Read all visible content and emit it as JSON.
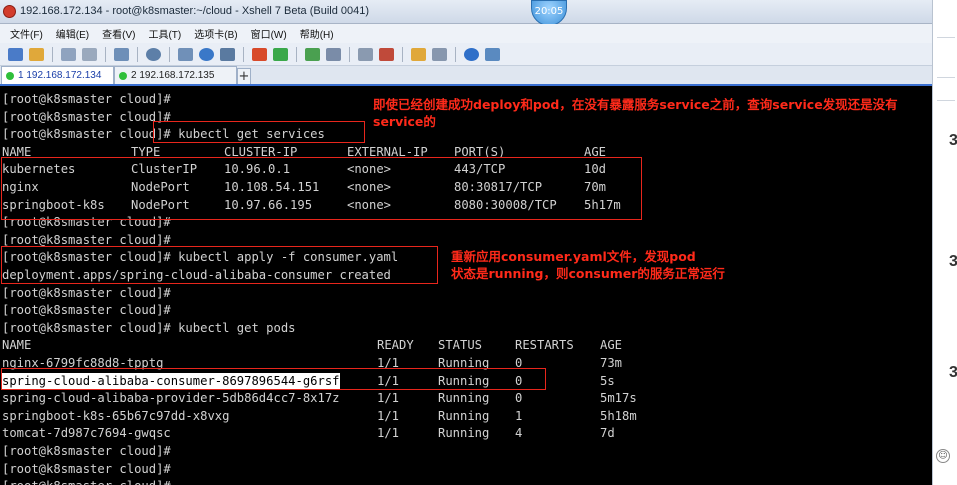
{
  "window": {
    "title": "192.168.172.134 - root@k8smaster:~/cloud - Xshell 7 Beta (Build 0041)",
    "clock": "20:05"
  },
  "menu": [
    "文件(F)",
    "编辑(E)",
    "查看(V)",
    "工具(T)",
    "选项卡(B)",
    "窗口(W)",
    "帮助(H)"
  ],
  "tabs": [
    {
      "label": "1 192.168.172.134",
      "status_color": "#2fbf3a"
    },
    {
      "label": "2 192.168.172.135",
      "status_color": "#2fbf3a"
    }
  ],
  "tab_add": "+",
  "terminal": {
    "prompt": "[root@k8smaster cloud]#",
    "cmd_services": "[root@k8smaster cloud]# kubectl get services",
    "services": {
      "headers": [
        "NAME",
        "TYPE",
        "CLUSTER-IP",
        "EXTERNAL-IP",
        "PORT(S)",
        "AGE"
      ],
      "rows": [
        [
          "kubernetes",
          "ClusterIP",
          "10.96.0.1",
          "<none>",
          "443/TCP",
          "10d"
        ],
        [
          "nginx",
          "NodePort",
          "10.108.54.151",
          "<none>",
          "80:30817/TCP",
          "70m"
        ],
        [
          "springboot-k8s",
          "NodePort",
          "10.97.66.195",
          "<none>",
          "8080:30008/TCP",
          "5h17m"
        ]
      ]
    },
    "cmd_apply": "[root@k8smaster cloud]# kubectl apply -f consumer.yaml",
    "apply_result": "deployment.apps/spring-cloud-alibaba-consumer created",
    "cmd_pods": "[root@k8smaster cloud]# kubectl get pods",
    "pods": {
      "headers": [
        "NAME",
        "READY",
        "STATUS",
        "RESTARTS",
        "AGE"
      ],
      "rows": [
        [
          "nginx-6799fc88d8-tpptg",
          "1/1",
          "Running",
          "0",
          "73m"
        ],
        [
          "spring-cloud-alibaba-consumer-8697896544-g6rsf",
          "1/1",
          "Running",
          "0",
          "5s"
        ],
        [
          "spring-cloud-alibaba-provider-5db86d4cc7-8x17z",
          "1/1",
          "Running",
          "0",
          "5m17s"
        ],
        [
          "springboot-k8s-65b67c97dd-x8vxg",
          "1/1",
          "Running",
          "1",
          "5h18m"
        ],
        [
          "tomcat-7d987c7694-gwqsc",
          "1/1",
          "Running",
          "4",
          "7d"
        ]
      ]
    }
  },
  "annotations": {
    "note1_line1": "即使已经创建成功deploy和pod，在没有暴露服务service之前，查询service发现还是没有",
    "note1_line2": "service的",
    "note2_line1": "重新应用consumer.yaml文件，发现pod",
    "note2_line2": "状态是running，则consumer的服务正常运行",
    "color": "#ff2a1a"
  },
  "side_panel": {
    "glyph": "3",
    "circle_glyph": "☺"
  }
}
